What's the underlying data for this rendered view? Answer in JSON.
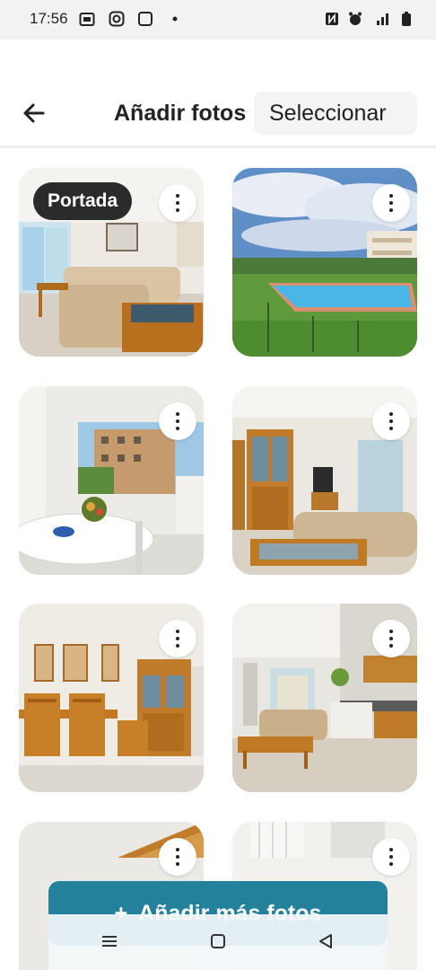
{
  "status_bar": {
    "time": "17:56",
    "icons": [
      "calendar-icon",
      "instagram-icon",
      "screen-record-icon",
      "dot-icon",
      "nfc-icon",
      "alarm-icon",
      "signal-icon",
      "battery-icon"
    ]
  },
  "header": {
    "title": "Añadir fotos",
    "select_label": "Seleccionar"
  },
  "photos": [
    {
      "badge": "Portada",
      "scene": "living-room-window"
    },
    {
      "badge": "",
      "scene": "pool-exterior"
    },
    {
      "badge": "",
      "scene": "dining-balcony"
    },
    {
      "badge": "",
      "scene": "living-room-cabinet"
    },
    {
      "badge": "",
      "scene": "dining-room"
    },
    {
      "badge": "",
      "scene": "living-kitchen"
    },
    {
      "badge": "",
      "scene": "partial-stairs"
    },
    {
      "badge": "",
      "scene": "partial-window"
    }
  ],
  "add_button": {
    "label": "Añadir más fotos",
    "icon": "plus-icon",
    "color": "#23819c"
  },
  "nav_bar": {
    "icons": [
      "recent-apps-icon",
      "home-icon",
      "back-triangle-icon"
    ]
  }
}
